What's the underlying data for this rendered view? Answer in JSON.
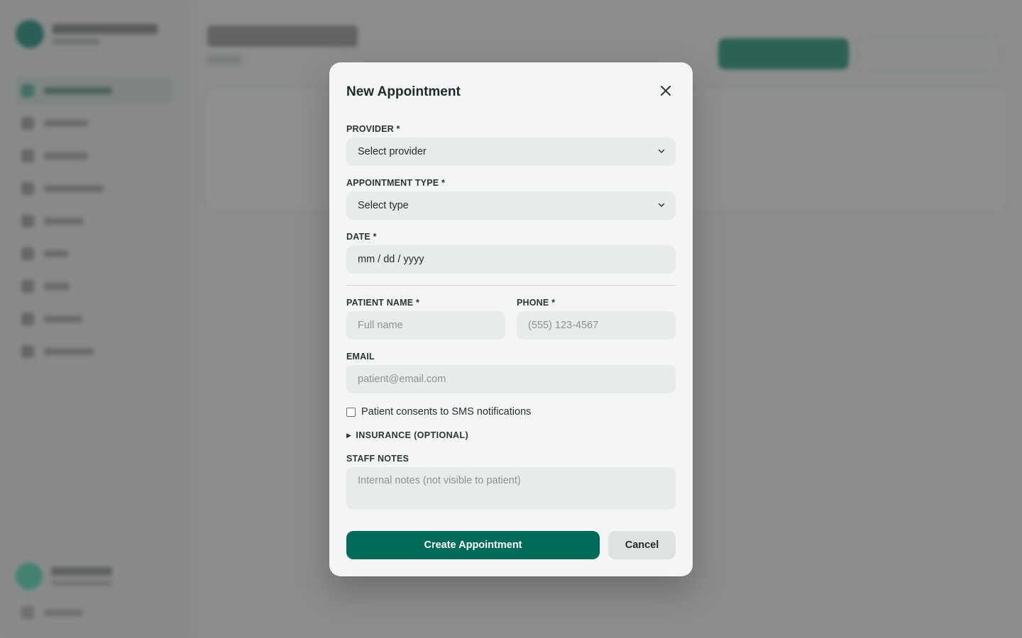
{
  "colors": {
    "accent": "#006a58",
    "modal_bg": "#f3f5f7",
    "field_bg": "#e8ebec",
    "backdrop": "#8e9190"
  },
  "modal": {
    "title": "New Appointment",
    "close_icon": "close-icon",
    "provider": {
      "label": "PROVIDER *",
      "value": "Select provider",
      "icon": "chevron-down-icon"
    },
    "appointment_type": {
      "label": "APPOINTMENT TYPE *",
      "value": "Select type",
      "icon": "chevron-down-icon"
    },
    "date": {
      "label": "DATE *",
      "value": "mm / dd / yyyy"
    },
    "patient_name": {
      "label": "PATIENT NAME *",
      "placeholder": "Full name"
    },
    "phone": {
      "label": "PHONE *",
      "placeholder": "(555) 123-4567"
    },
    "email": {
      "label": "EMAIL",
      "placeholder": "patient@email.com"
    },
    "sms_consent": {
      "label": "Patient consents to SMS notifications",
      "checked": false
    },
    "insurance": {
      "label": "INSURANCE (OPTIONAL)",
      "icon": "triangle-right-icon"
    },
    "staff_notes": {
      "label": "STAFF NOTES",
      "placeholder": "Internal notes (not visible to patient)"
    },
    "create_label": "Create Appointment",
    "cancel_label": "Cancel"
  }
}
